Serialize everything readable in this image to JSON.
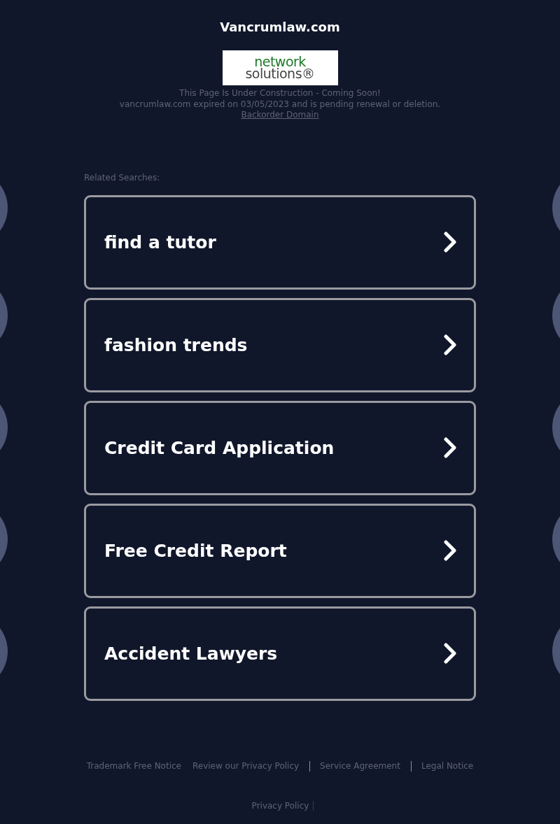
{
  "title": "Vancrumlaw.com",
  "logo": {
    "line_1": "network",
    "line_2": "solutions®"
  },
  "notice": {
    "line_1": "This Page Is Under Construction - Coming Soon!",
    "line_2": "vancrumlaw.com expired on 03/05/2023 and is pending renewal or deletion.",
    "link": "Backorder Domain"
  },
  "related_label": "Related Searches:",
  "searches": [
    "find a tutor",
    "fashion trends",
    "Credit Card Application",
    "Free Credit Report",
    "Accident Lawyers"
  ],
  "footer_links": [
    "Trademark Free Notice",
    "Review our Privacy Policy",
    "Service Agreement",
    "Legal Notice"
  ],
  "footer_bottom": "Privacy Policy"
}
